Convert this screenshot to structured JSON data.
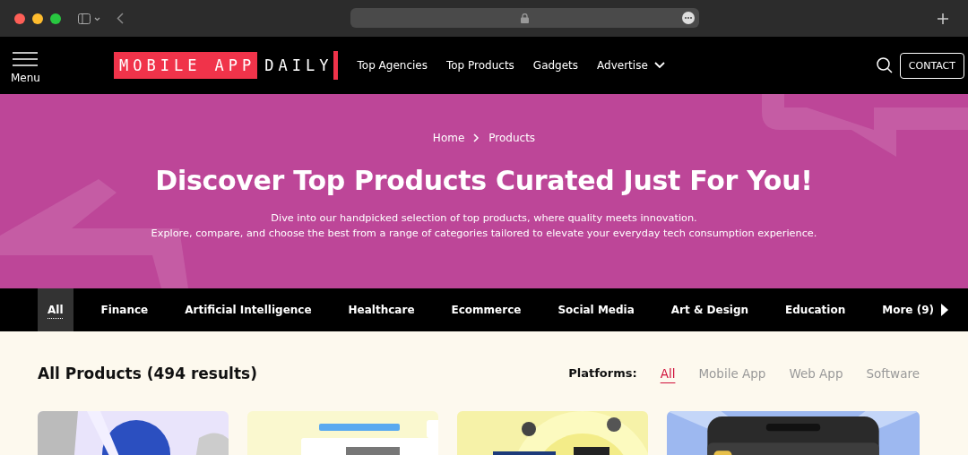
{
  "nav": {
    "menu_label": "Menu",
    "logo": {
      "boxed": "MOBILE APP",
      "plain": "DAILY"
    },
    "links": [
      {
        "label": "Top Agencies",
        "dropdown": false
      },
      {
        "label": "Top Products",
        "dropdown": false
      },
      {
        "label": "Gadgets",
        "dropdown": false
      },
      {
        "label": "Advertise",
        "dropdown": true
      }
    ],
    "contact": "CONTACT"
  },
  "hero": {
    "breadcrumb": [
      "Home",
      "Products"
    ],
    "title": "Discover Top Products Curated Just For You!",
    "lines": [
      "Dive into our handpicked selection of top products, where quality meets innovation.",
      "Explore, compare, and choose the best from a range of categories tailored to elevate your everyday tech consumption experience."
    ]
  },
  "categories": [
    {
      "label": "All",
      "selected": true
    },
    {
      "label": "Finance",
      "selected": false
    },
    {
      "label": "Artificial Intelligence",
      "selected": false
    },
    {
      "label": "Healthcare",
      "selected": false
    },
    {
      "label": "Ecommerce",
      "selected": false
    },
    {
      "label": "Social Media",
      "selected": false
    },
    {
      "label": "Art & Design",
      "selected": false
    },
    {
      "label": "Education",
      "selected": false
    },
    {
      "label": "More (9)",
      "selected": false
    }
  ],
  "products": {
    "heading": "All Products (494 results)",
    "platforms_label": "Platforms:",
    "platforms": [
      {
        "label": "All",
        "selected": true
      },
      {
        "label": "Mobile App",
        "selected": false
      },
      {
        "label": "Web App",
        "selected": false
      },
      {
        "label": "Software",
        "selected": false
      }
    ]
  }
}
